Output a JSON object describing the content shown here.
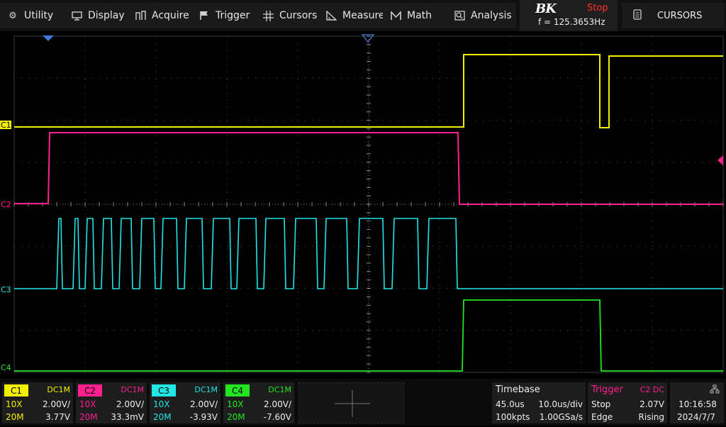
{
  "menu": {
    "items": [
      {
        "label": "Utility",
        "icon": "gear-icon"
      },
      {
        "label": "Display",
        "icon": "monitor-icon"
      },
      {
        "label": "Acquire",
        "icon": "acquire-icon"
      },
      {
        "label": "Trigger",
        "icon": "flag-icon"
      },
      {
        "label": "Cursors",
        "icon": "crosshair-icon"
      },
      {
        "label": "Measure",
        "icon": "ruler-icon"
      },
      {
        "label": "Math",
        "icon": "math-icon"
      },
      {
        "label": "Analysis",
        "icon": "analysis-icon"
      }
    ],
    "brand": "BK",
    "run_state": "Stop",
    "frequency": "f = 125.3653Hz",
    "right_panel": "CURSORS"
  },
  "channels": [
    {
      "tag": "C1",
      "coupling": "DC1M",
      "probe": "10X",
      "scale": "2.00V/",
      "bw": "20M",
      "offset": "3.77V",
      "color": "#f0f000"
    },
    {
      "tag": "C2",
      "coupling": "DC1M",
      "probe": "10X",
      "scale": "2.00V/",
      "bw": "20M",
      "offset": "33.3mV",
      "color": "#ff1f8e"
    },
    {
      "tag": "C3",
      "coupling": "DC1M",
      "probe": "10X",
      "scale": "2.00V/",
      "bw": "20M",
      "offset": "-3.93V",
      "color": "#22e6e6"
    },
    {
      "tag": "C4",
      "coupling": "DC1M",
      "probe": "10X",
      "scale": "2.00V/",
      "bw": "20M",
      "offset": "-7.60V",
      "color": "#22e622"
    }
  ],
  "markers": {
    "c1": "C1",
    "c2": "C2",
    "c3": "C3",
    "c4": "C4"
  },
  "timebase": {
    "title": "Timebase",
    "delay": "45.0us",
    "scale": "10.0us/div",
    "depth": "100kpts",
    "rate": "1.00GSa/s"
  },
  "trigger": {
    "title": "Trigger",
    "source": "C2 DC",
    "state": "Stop",
    "level": "2.07V",
    "type": "Edge",
    "slope": "Rising"
  },
  "clock": {
    "time": "10:16:58",
    "date": "2024/7/7"
  }
}
